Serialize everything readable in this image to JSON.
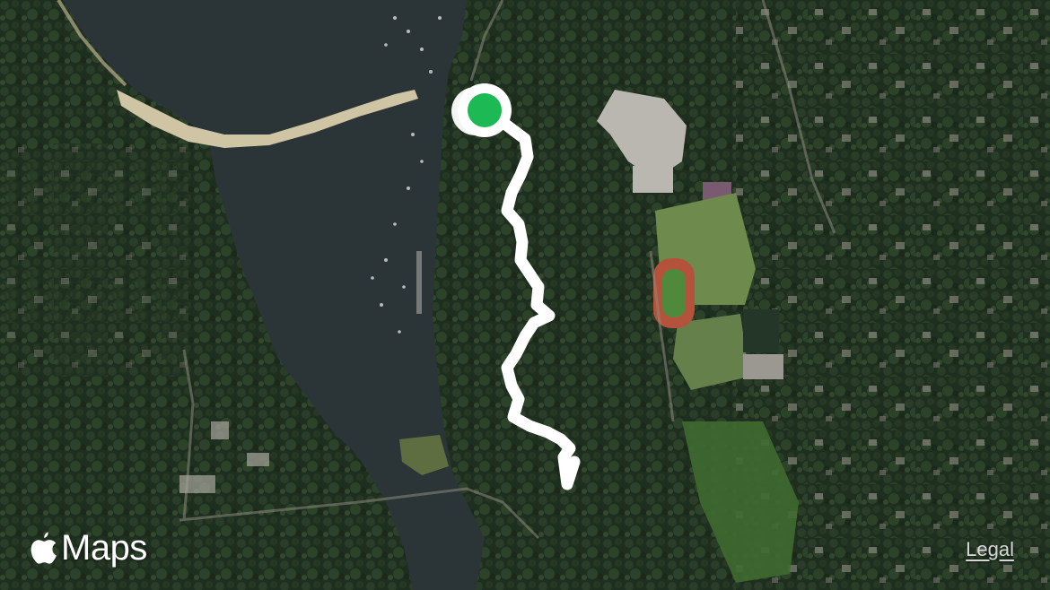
{
  "map": {
    "view": "satellite",
    "route_color": "#ffffff",
    "start_marker_color": "#1db954",
    "colors": {
      "water": "#2b3538",
      "forest": "#223323",
      "sand": "#c9bfa0",
      "field": "#6e8a4c",
      "track": "#b4533c",
      "route": "#ffffff",
      "start_marker": "#1db954"
    }
  },
  "branding": {
    "label": "Maps",
    "apple_icon": "apple-logo-icon"
  },
  "legal_link": "Legal"
}
